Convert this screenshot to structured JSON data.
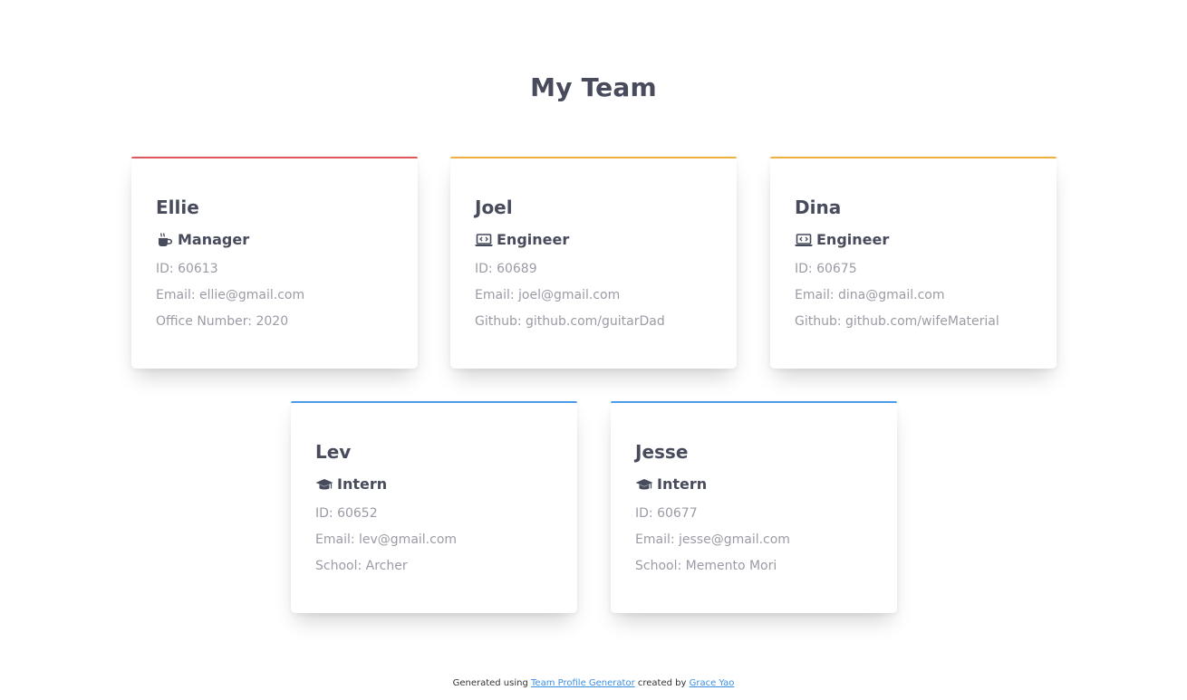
{
  "header": {
    "title": "My Team"
  },
  "cards": [
    {
      "name": "Ellie",
      "role": "Manager",
      "icon": "coffee-icon",
      "accent": "#e0575b",
      "lines": [
        "ID: 60613",
        "Email: ellie@gmail.com",
        "Office Number: 2020"
      ]
    },
    {
      "name": "Joel",
      "role": "Engineer",
      "icon": "laptop-code-icon",
      "accent": "#f0b040",
      "lines": [
        "ID: 60689",
        "Email: joel@gmail.com",
        "Github: github.com/guitarDad"
      ]
    },
    {
      "name": "Dina",
      "role": "Engineer",
      "icon": "laptop-code-icon",
      "accent": "#f0b040",
      "lines": [
        "ID: 60675",
        "Email: dina@gmail.com",
        "Github: github.com/wifeMaterial"
      ]
    },
    {
      "name": "Lev",
      "role": "Intern",
      "icon": "graduation-cap-icon",
      "accent": "#4a9be8",
      "lines": [
        "ID: 60652",
        "Email: lev@gmail.com",
        "School: Archer"
      ]
    },
    {
      "name": "Jesse",
      "role": "Intern",
      "icon": "graduation-cap-icon",
      "accent": "#4a9be8",
      "lines": [
        "ID: 60677",
        "Email: jesse@gmail.com",
        "School: Memento Mori"
      ]
    }
  ],
  "footer": {
    "prefix": "Generated using",
    "link1": "Team Profile Generator",
    "middle": "created by",
    "link2": "Grace Yao"
  }
}
